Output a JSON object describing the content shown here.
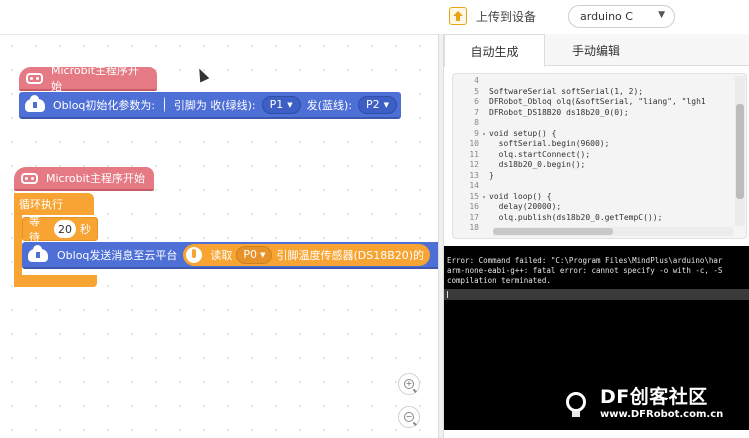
{
  "toolbar": {
    "upload_label": "上传到设备",
    "upload_icon": "upload-arrow-icon",
    "board_select": "arduino C"
  },
  "workspace": {
    "group1": {
      "hat_label": "Microbit主程序开始",
      "init_block": {
        "prefix": "Obloq初始化参数为:",
        "pins_label": "引脚为 收(绿线):",
        "rx_pin": "P1",
        "tx_label": "发(蓝线):",
        "tx_pin": "P2"
      }
    },
    "group2": {
      "hat_label": "Microbit主程序开始",
      "loop_label": "循环执行",
      "wait_label": "等待",
      "wait_value": "20",
      "wait_unit": "秒",
      "send_label": "Obloq发送消息至云平台",
      "read_label": "读取",
      "read_pin": "P0",
      "sensor_label": "引脚温度传感器(DS18B20)的"
    },
    "zoom_in_label": "+",
    "zoom_out_label": "−"
  },
  "tabs": [
    {
      "label": "自动生成",
      "active": true
    },
    {
      "label": "手动编辑",
      "active": false
    }
  ],
  "code": {
    "lines": [
      {
        "n": "4",
        "fold": "",
        "text": ""
      },
      {
        "n": "5",
        "fold": "",
        "text": "SoftwareSerial softSerial(1, 2);"
      },
      {
        "n": "6",
        "fold": "",
        "text": "DFRobot_Obloq olq(&softSerial, \"liang\", \"lgh1"
      },
      {
        "n": "7",
        "fold": "",
        "text": "DFRobot_DS18B20 ds18b20_0(0);"
      },
      {
        "n": "8",
        "fold": "",
        "text": ""
      },
      {
        "n": "9",
        "fold": "▾",
        "text": "void setup() {"
      },
      {
        "n": "10",
        "fold": "",
        "text": "  softSerial.begin(9600);"
      },
      {
        "n": "11",
        "fold": "",
        "text": "  olq.startConnect();"
      },
      {
        "n": "12",
        "fold": "",
        "text": "  ds18b20_0.begin();"
      },
      {
        "n": "13",
        "fold": "",
        "text": "}"
      },
      {
        "n": "14",
        "fold": "",
        "text": ""
      },
      {
        "n": "15",
        "fold": "▾",
        "text": "void loop() {"
      },
      {
        "n": "16",
        "fold": "",
        "text": "  delay(20000);"
      },
      {
        "n": "17",
        "fold": "",
        "text": "  olq.publish(ds18b20_0.getTempC());"
      },
      {
        "n": "18",
        "fold": "",
        "text": ""
      }
    ]
  },
  "console": {
    "lines": [
      "Error: Command failed: \"C:\\Program Files\\MindPlus\\arduino\\har",
      "arm-none-eabi-g++: fatal error: cannot specify -o with -c, -S",
      "compilation terminated."
    ]
  },
  "logo": {
    "main": "DF创客社区",
    "sub": "www.DFRobot.com.cn"
  },
  "colors": {
    "hat_pink": "#e67a84",
    "obloq_blue": "#4e6fd6",
    "control_orange": "#f7a432",
    "console_bg": "#000000"
  }
}
